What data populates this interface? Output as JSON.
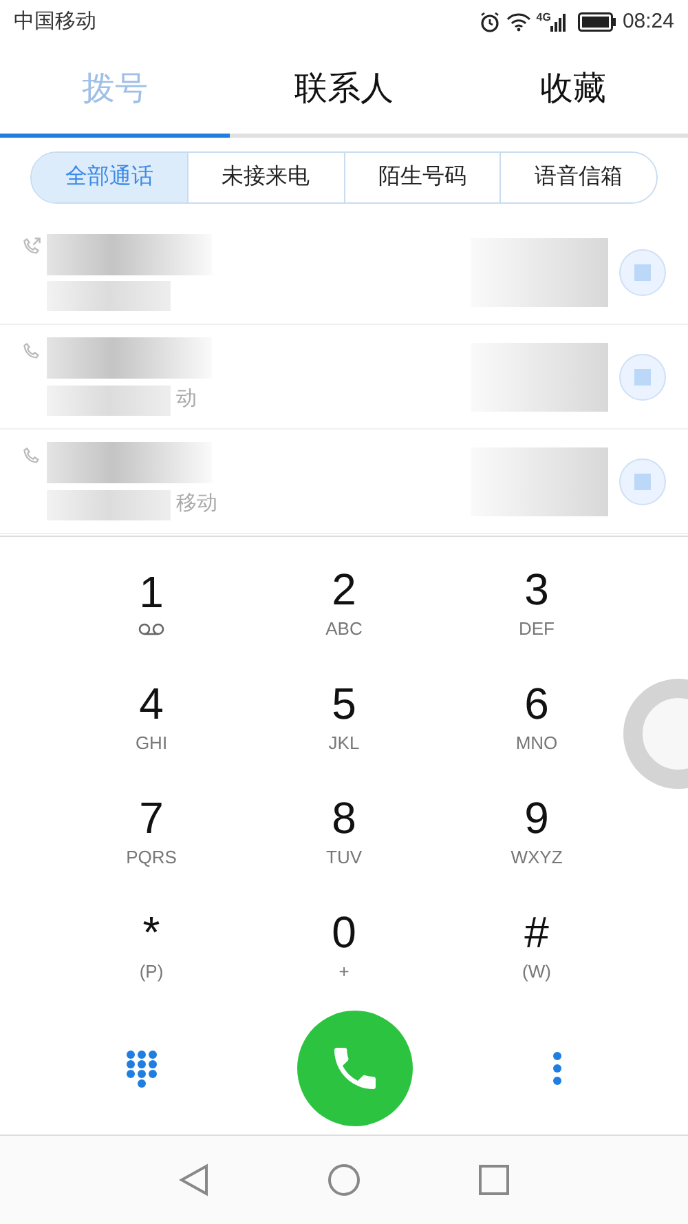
{
  "status_bar": {
    "carrier": "中国移动",
    "network": "4G",
    "time": "08:24"
  },
  "tabs": [
    {
      "label": "拨号",
      "selected": true
    },
    {
      "label": "联系人",
      "selected": false
    },
    {
      "label": "收藏",
      "selected": false
    }
  ],
  "filters": [
    {
      "label": "全部通话",
      "selected": true
    },
    {
      "label": "未接来电",
      "selected": false
    },
    {
      "label": "陌生号码",
      "selected": false
    },
    {
      "label": "语音信箱",
      "selected": false
    }
  ],
  "call_log": [
    {
      "kind": "outgoing"
    },
    {
      "kind": "call",
      "location": "动"
    },
    {
      "kind": "call",
      "location": "移动"
    }
  ],
  "keypad": [
    {
      "digit": "1",
      "kind": "voicemail"
    },
    {
      "digit": "2",
      "kind": "letters",
      "sub": "ABC"
    },
    {
      "digit": "3",
      "kind": "letters",
      "sub": "DEF"
    },
    {
      "digit": "4",
      "kind": "letters",
      "sub": "GHI"
    },
    {
      "digit": "5",
      "kind": "letters",
      "sub": "JKL"
    },
    {
      "digit": "6",
      "kind": "letters",
      "sub": "MNO"
    },
    {
      "digit": "7",
      "kind": "letters",
      "sub": "PQRS"
    },
    {
      "digit": "8",
      "kind": "letters",
      "sub": "TUV"
    },
    {
      "digit": "9",
      "kind": "letters",
      "sub": "WXYZ"
    },
    {
      "digit": "*",
      "kind": "letters",
      "sub": "(P)"
    },
    {
      "digit": "0",
      "kind": "letters",
      "sub": "+"
    },
    {
      "digit": "#",
      "kind": "letters",
      "sub": "(W)"
    }
  ]
}
